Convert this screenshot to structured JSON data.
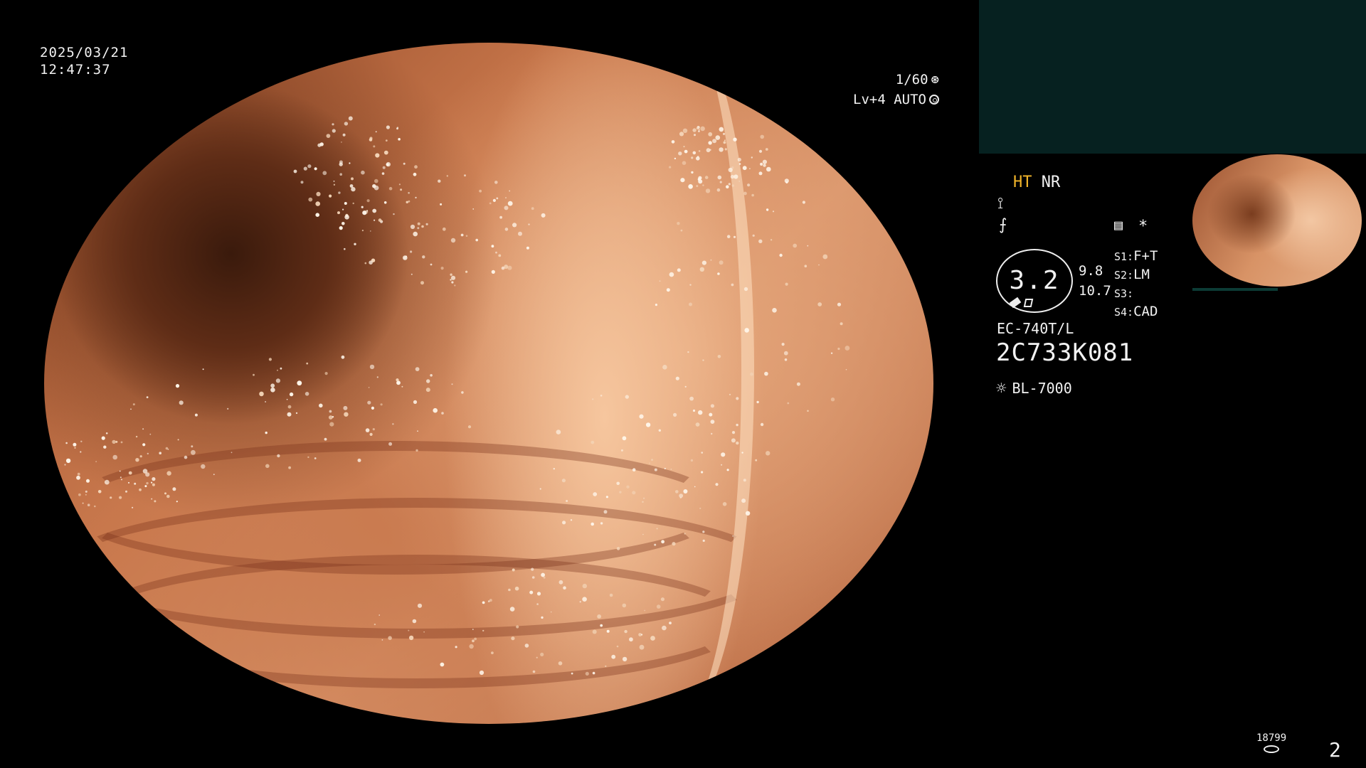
{
  "overlay": {
    "date": "2025/03/21",
    "time": "12:47:37",
    "shutter": "1/60",
    "iris": "Lv+4 AUTO"
  },
  "panel": {
    "mode_ht": "HT",
    "mode_nr": "NR",
    "gauge_value": "3.2",
    "gauge_upper": "9.8",
    "gauge_lower": "10.7",
    "star": "*",
    "switches": [
      {
        "key": "S1:",
        "value": "F+T"
      },
      {
        "key": "S2:",
        "value": "LM"
      },
      {
        "key": "S3:",
        "value": ""
      },
      {
        "key": "S4:",
        "value": "CAD"
      }
    ],
    "scope_model": "EC-740T/L",
    "scope_serial": "2C733K081",
    "light_source": "BL-7000"
  },
  "footer": {
    "memory_count": "18799",
    "page_number": "2"
  },
  "icons": {
    "shutter": "aperture-icon",
    "iris": "auto-iris-icon",
    "enhance": "enhance-icon",
    "sharpness": "sharpness-icon",
    "record": "record-icon",
    "light": "sun-icon",
    "memory": "memory-icon"
  },
  "colors": {
    "mode_ht": "#f2b52a",
    "sub_screen": "#062120"
  }
}
